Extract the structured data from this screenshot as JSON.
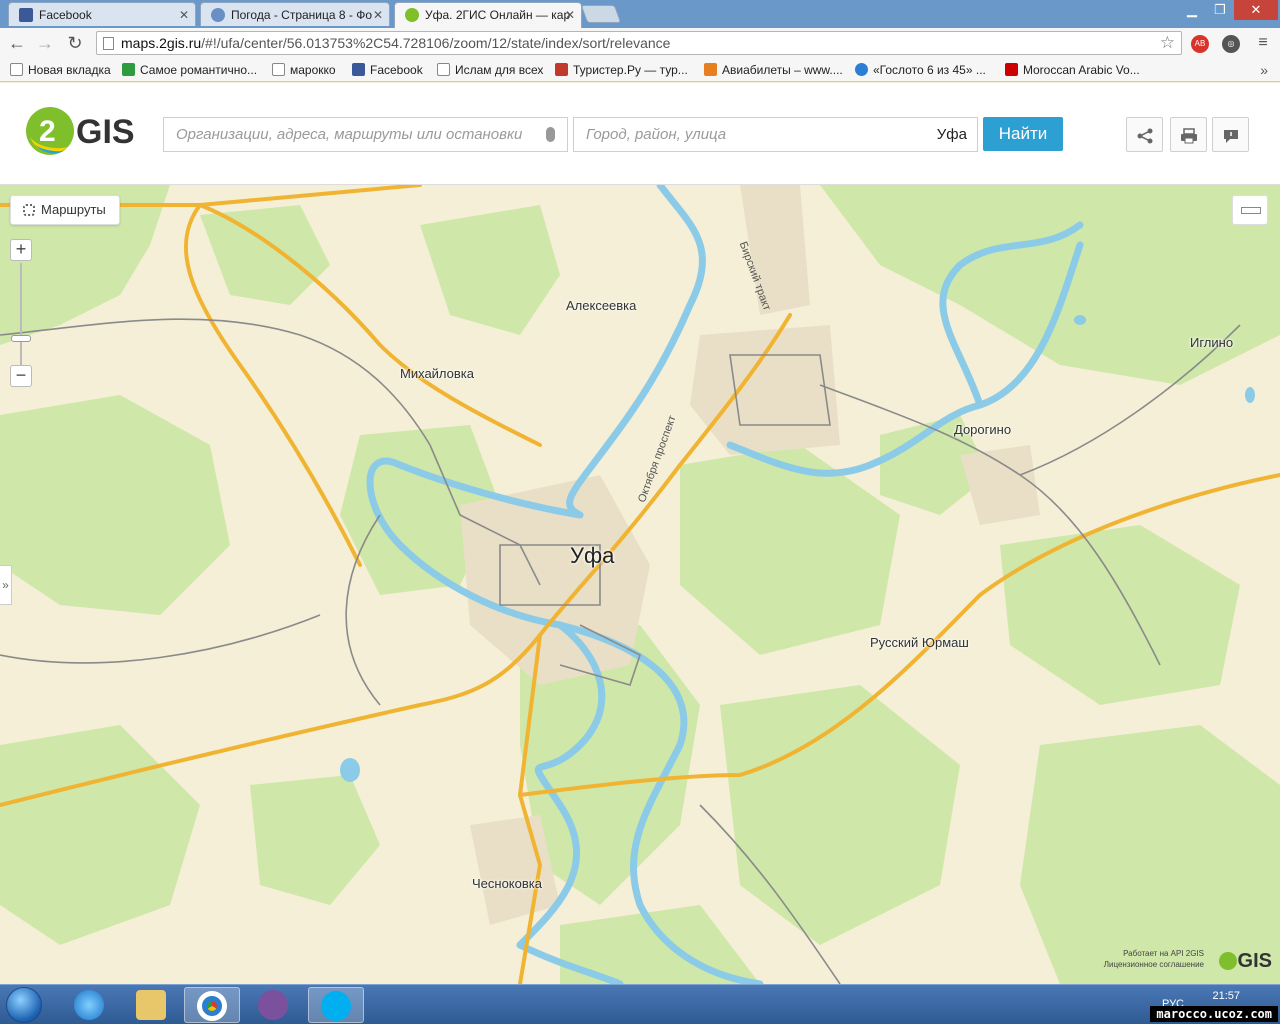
{
  "browser": {
    "tabs": [
      {
        "label": "Facebook",
        "favicon_color": "#3b5998"
      },
      {
        "label": "Погода - Страница 8 - Фо",
        "favicon_color": "#6a8fc4"
      },
      {
        "label": "Уфа. 2ГИС Онлайн — кар",
        "favicon_color": "#7fbf2c"
      }
    ],
    "url_domain": "maps.2gis.ru",
    "url_path": "/#!/ufa/center/56.013753%2C54.728106/zoom/12/state/index/sort/relevance",
    "bookmarks": [
      {
        "label": "Новая вкладка",
        "icon_color": "#ffffff"
      },
      {
        "label": "Самое романтично...",
        "icon_color": "#2e9b3f"
      },
      {
        "label": "марокко",
        "icon_color": "#ffffff"
      },
      {
        "label": "Facebook",
        "icon_color": "#3b5998"
      },
      {
        "label": "Ислам для всех",
        "icon_color": "#ffffff"
      },
      {
        "label": "Туристер.Ру — тур...",
        "icon_color": "#c0392b"
      },
      {
        "label": "Авиабилеты – www....",
        "icon_color": "#e67e22"
      },
      {
        "label": "«Гослото 6 из 45» ...",
        "icon_color": "#2a7fd4"
      },
      {
        "label": "Moroccan Arabic Vo...",
        "icon_color": "#cc0000"
      }
    ],
    "bookmarks_more": "»"
  },
  "gis": {
    "search_placeholder": "Организации, адреса, маршруты или остановки",
    "city_placeholder": "Город, район, улица",
    "city_value": "Уфа",
    "find_label": "Найти",
    "logo_text": "GIS",
    "logo_digit": "2"
  },
  "map": {
    "routes_label": "Маршруты",
    "zoom_in": "+",
    "zoom_out": "−",
    "side_toggle": "»",
    "places": {
      "ufa": "Уфа",
      "alekseevka": "Алексеевка",
      "mikhailovka": "Михайловка",
      "iglino": "Иглино",
      "dorogino": "Дорогино",
      "russkiy_yurmash": "Русский Юрмаш",
      "chesnokovka": "Чесноковка"
    },
    "streets": {
      "birsky_trakt": "Бирский тракт",
      "oktyabrya_prospekt": "Октября проспект"
    },
    "attribution": {
      "line1": "Работает на API 2GIS",
      "line2": "Лицензионное соглашение",
      "logo": "GIS"
    }
  },
  "taskbar": {
    "language": "РУС",
    "time": "21:57",
    "watermark": "marocco.ucoz.com"
  }
}
